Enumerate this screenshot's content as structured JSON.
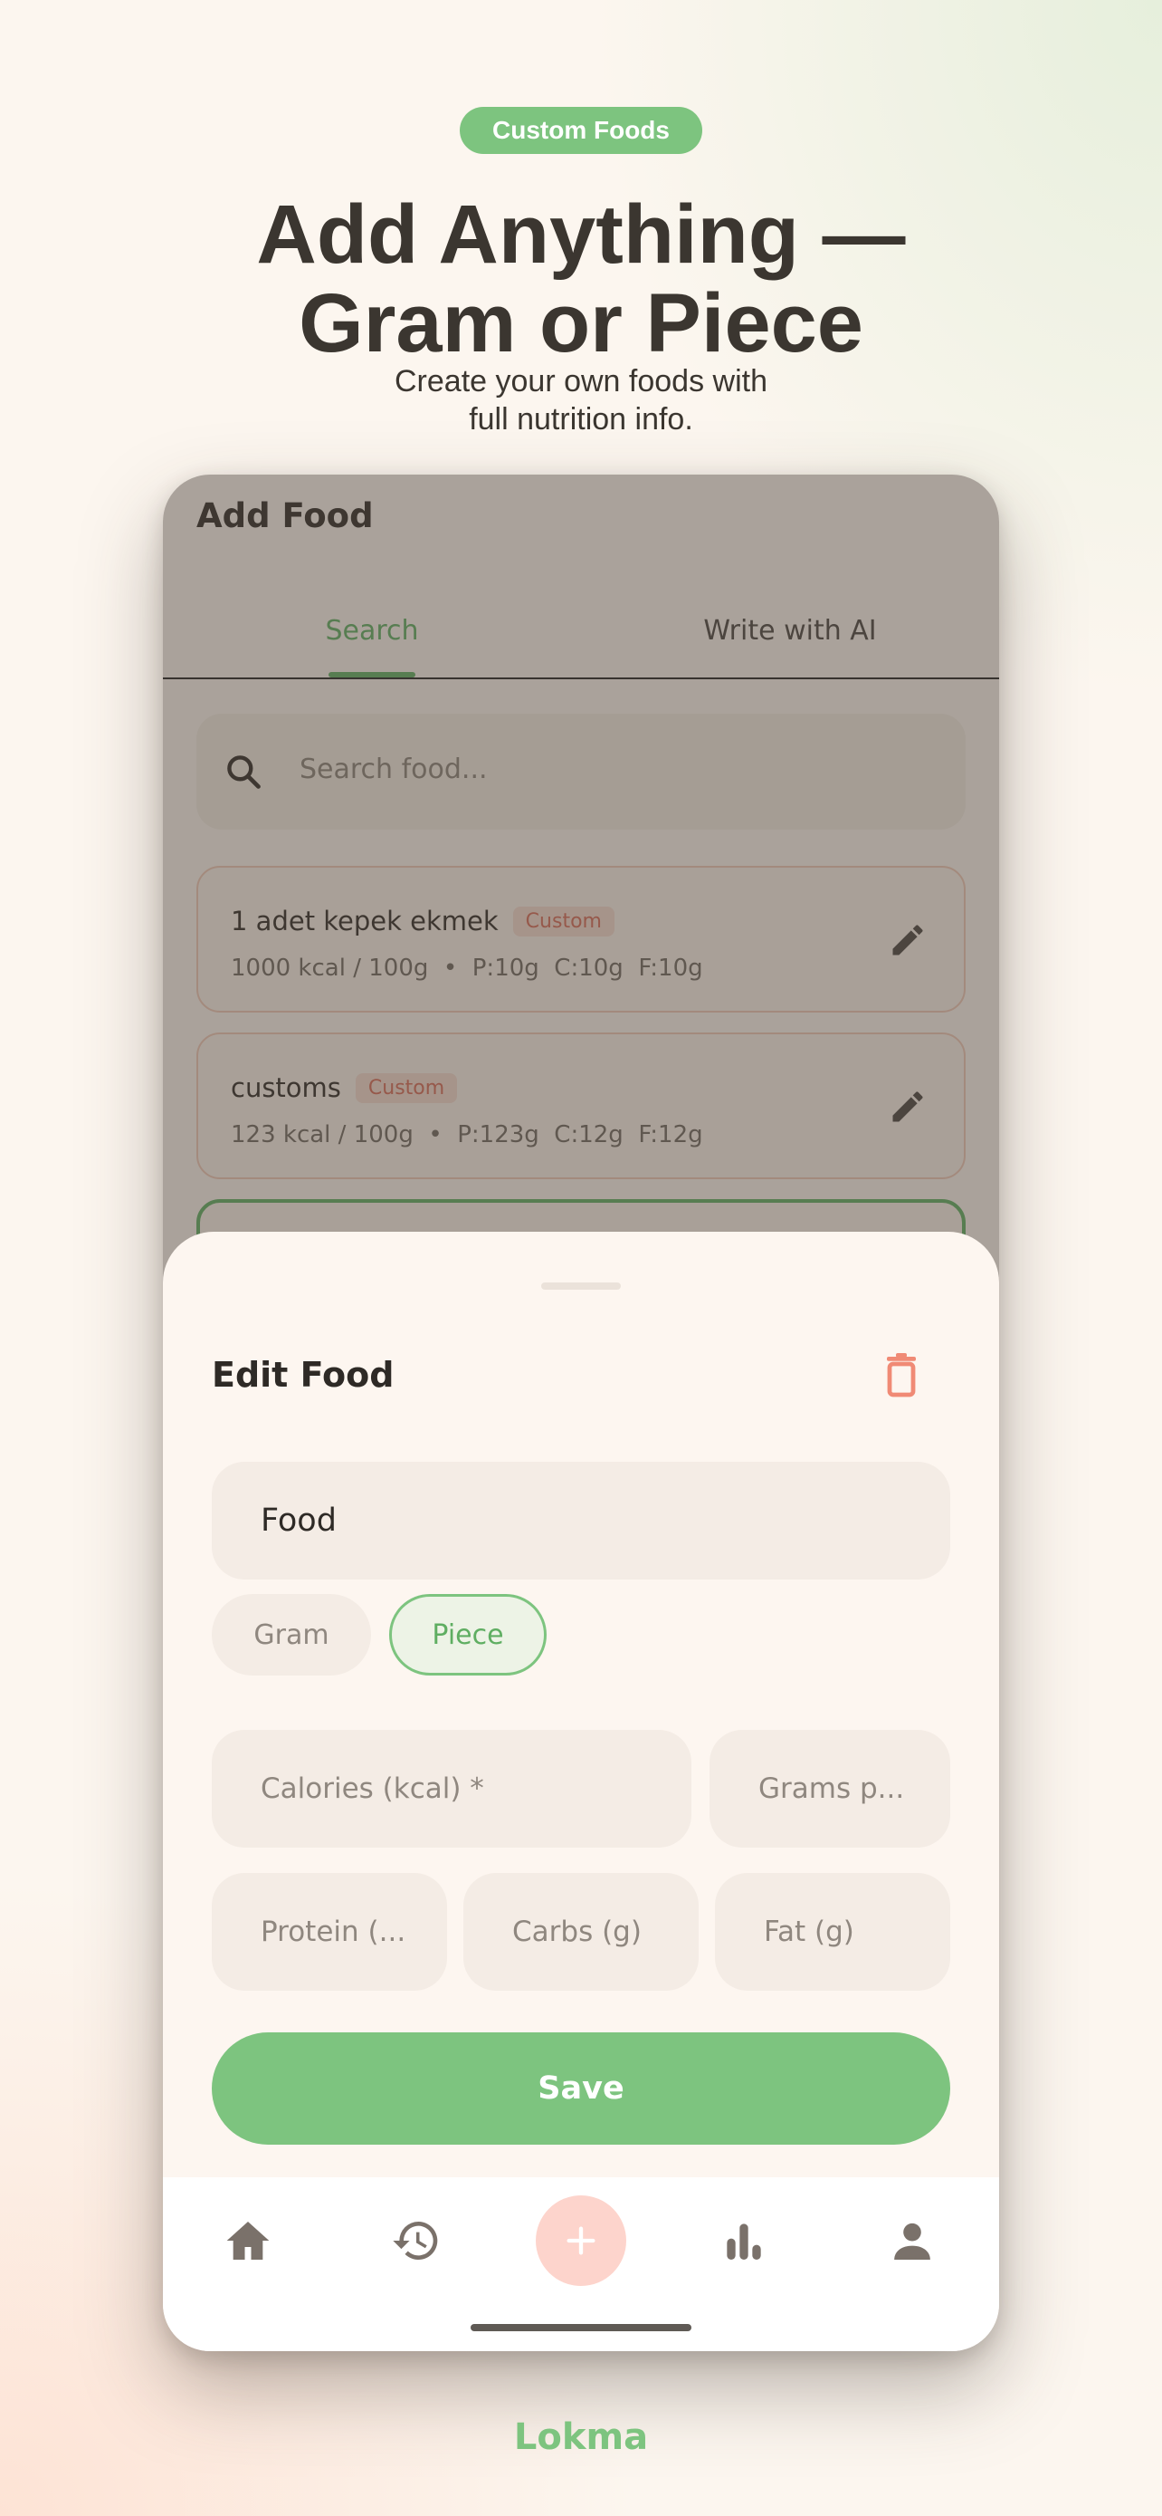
{
  "hero": {
    "badge": "Custom Foods",
    "title_line1": "Add Anything —",
    "title_line2": "Gram or Piece",
    "subtitle_line1": "Create your own foods with",
    "subtitle_line2": "full nutrition info."
  },
  "screen": {
    "title": "Add Food",
    "tabs": [
      {
        "label": "Search",
        "active": true
      },
      {
        "label": "Write with AI",
        "active": false
      }
    ],
    "search": {
      "placeholder": "Search food..."
    },
    "foods": [
      {
        "name": "1 adet kepek ekmek",
        "tag": "Custom",
        "meta": "1000 kcal / 100g  •  P:10g  C:10g  F:10g"
      },
      {
        "name": "customs",
        "tag": "Custom",
        "meta": "123 kcal / 100g  •  P:123g  C:12g  F:12g"
      }
    ]
  },
  "sheet": {
    "title": "Edit Food",
    "name_value": "Food",
    "unit_options": [
      {
        "label": "Gram",
        "selected": false
      },
      {
        "label": "Piece",
        "selected": true
      }
    ],
    "calories_placeholder": "Calories (kcal) *",
    "grams_placeholder": "Grams p...",
    "protein_placeholder": "Protein (...",
    "carbs_placeholder": "Carbs (g)",
    "fat_placeholder": "Fat (g)",
    "save_label": "Save",
    "add_glyph": "+"
  },
  "nav": {
    "items": [
      "home-icon",
      "history-icon",
      "add-icon",
      "stats-icon",
      "profile-icon"
    ]
  },
  "brand": "Lokma",
  "colors": {
    "accent_green": "#7dc47f",
    "tag_red": "#d76a57",
    "add_button": "#fdd4cc",
    "text_dark": "#3b3630"
  }
}
